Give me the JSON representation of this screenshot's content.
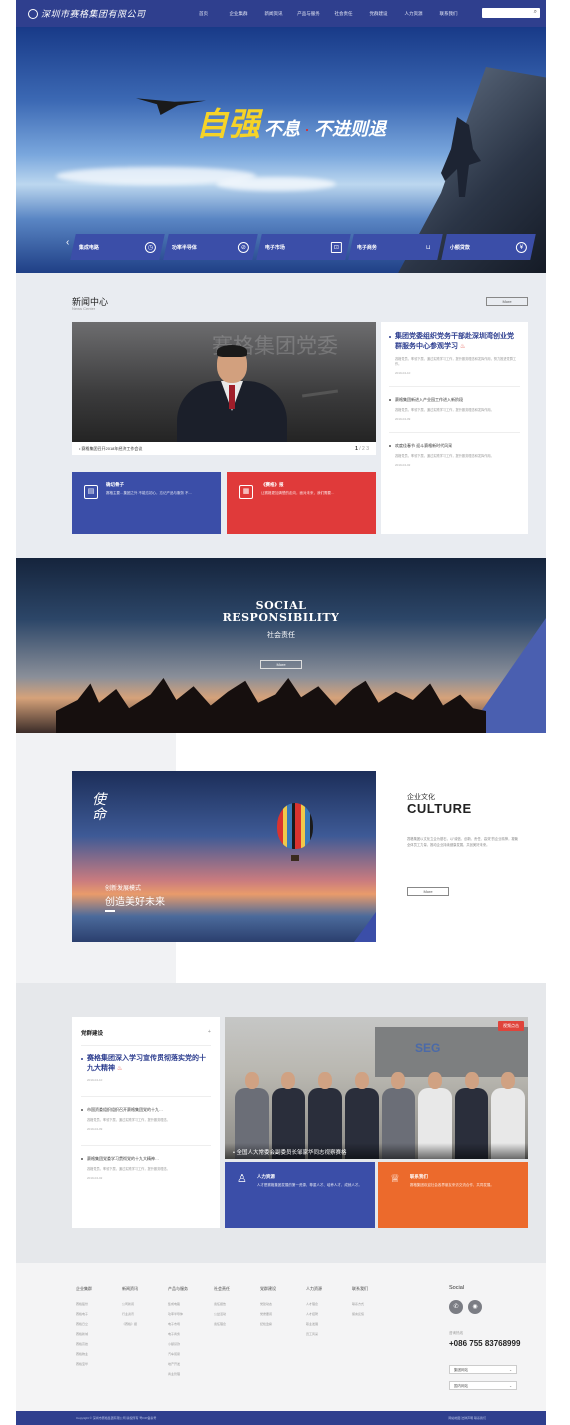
{
  "header": {
    "logo_text": "深圳市赛格集团有限公司",
    "nav": [
      "首页",
      "企业集群",
      "新闻资讯",
      "产品与服务",
      "社会责任",
      "党群建设",
      "人力资源",
      "联系我们"
    ],
    "search_icon": "search-icon",
    "lang": "EN/其他语言"
  },
  "hero": {
    "slogan": [
      "自强",
      "不息",
      "·",
      "不进则退"
    ],
    "business": [
      {
        "title": "集成电路",
        "icon": "chip-icon",
        "glyph": "◷"
      },
      {
        "title": "功率半导体",
        "icon": "compass-icon",
        "glyph": "⊘"
      },
      {
        "title": "电子市场",
        "icon": "cart-icon",
        "glyph": "⊡"
      },
      {
        "title": "电子商务",
        "icon": "shopping-cart-icon",
        "glyph": "⊔"
      },
      {
        "title": "小额贷款",
        "icon": "yen-icon",
        "glyph": "¥"
      }
    ]
  },
  "news": {
    "title": "新闻中心",
    "subtitle": "News Center",
    "more": "More",
    "watermark": "赛格集团党委",
    "caption": "• 赛格集团召开2018年经济工作会议",
    "pager_current": "1",
    "pager_rest": "/ 2 3",
    "tiles": [
      {
        "title": "确切骨子",
        "desc": "赛格主要…集团之外 不能忘初心，忘记产品与服务 不…",
        "color": "#3b4ea8",
        "icon": "document-icon"
      },
      {
        "title": "《赛格》报",
        "desc": "让赛格更加清楚的走向，面对未来，我们需要…",
        "color": "#e03a3a",
        "icon": "newspaper-icon"
      }
    ],
    "hot_title": "集团党委组织党务干部赴深圳湾创业党群服务中心参观学习",
    "hot_desc": "赛格党员，率领下属，通过实践学习工作，提升服务理念和发挥作用，努力推进党群工作。",
    "hot_date": "2019-04-10",
    "items": [
      {
        "title": "赛格集团新进入产业园工作进入新阶段",
        "desc": "赛格党员，率领下属，通过实践学习工作，提升服务理念和发挥作用。",
        "date": "2019-04-09"
      },
      {
        "title": "欢度佳春节 迎斗赛格新时代风采",
        "desc": "赛格党员，率领下属，通过实践学习工作，提升服务理念和发挥作用。",
        "date": "2019-04-02"
      }
    ]
  },
  "social": {
    "title_line1": "SOCIAL",
    "title_line2": "RESPONSIBILITY",
    "cn": "社会责任",
    "more": "More"
  },
  "culture": {
    "mission": "使命",
    "sub": "创新发展模式",
    "main": "创造美好未来",
    "cn": "企业文化",
    "en": "CULTURE",
    "desc": "赛格集团以文化立企为基石，以“诚信、创新、责任、高效”的企业精神，凝聚全体员工力量，推动企业持续健康发展，共创美好未来。",
    "more": "More"
  },
  "party": {
    "title": "党群建设",
    "plus": "+",
    "hot_title": "赛格集团深入学习宣传贯彻落实党的十九大精神",
    "hot_date": "2019-04-10",
    "items": [
      {
        "title": "市国资委组织组织召开赛格集团党的十九…",
        "desc": "赛格党员，率领下属，通过实践学习工作，提升服务理念。",
        "date": "2019-04-09"
      },
      {
        "title": "赛格集团党委学习贯彻党的十九大精神…",
        "desc": "赛格党员，率领下属，通过实践学习工作，提升服务理念。",
        "date": "2019-04-02"
      }
    ],
    "badge": "视频点击",
    "caption": "• 全国人大常委会副委员长邹家华同志视察赛格",
    "sign": "SEG",
    "tiles": [
      {
        "title": "人力资源",
        "desc": "人才是赛格集团发展的第一资源，尊重人才、培养人才、成就人才。",
        "color": "#3b4ea8",
        "icon": "user-icon",
        "glyph": "♙"
      },
      {
        "title": "联系我们",
        "desc": "赛格集团欢迎社会各界朋友来访交流合作，共同发展。",
        "color": "#ec6a2c",
        "icon": "trophy-icon",
        "glyph": "♕"
      }
    ]
  },
  "footer": {
    "columns": [
      {
        "head": "企业集群",
        "links": [
          "赛格股份",
          "赛格电子",
          "赛格日立",
          "赛格新城",
          "赛格高技",
          "赛格物业",
          "赛格宝华"
        ]
      },
      {
        "head": "新闻资讯",
        "links": [
          "公司新闻",
          "行业资讯",
          "《赛格》报"
        ]
      },
      {
        "head": "产品与服务",
        "links": [
          "集成电路",
          "功率半导体",
          "电子市场",
          "电子商务",
          "小额贷款",
          "汽车贸易",
          "地产开发",
          "商业管理"
        ]
      },
      {
        "head": "社会责任",
        "links": [
          "责任报告",
          "公益活动",
          "责任理念"
        ]
      },
      {
        "head": "党群建设",
        "links": [
          "党建动态",
          "党委要闻",
          "纪检监察"
        ]
      },
      {
        "head": "人力资源",
        "links": [
          "人才理念",
          "人才招聘",
          "职业发展",
          "员工风采"
        ]
      },
      {
        "head": "联系我们",
        "links": [
          "联系方式",
          "留言反馈"
        ]
      }
    ],
    "social": "Social",
    "social_icons": [
      {
        "name": "wechat-icon",
        "glyph": "✆"
      },
      {
        "name": "weibo-icon",
        "glyph": "◉"
      }
    ],
    "hotline_label": "咨询热线",
    "phone": "+086 755 83768999",
    "selects": [
      "集团网站",
      "国内网站"
    ],
    "copyright": "Copyright © 深圳市赛格集团有限公司 版权所有 粤ICP备案号",
    "links": "网站地图  法律声明  联系我们"
  }
}
